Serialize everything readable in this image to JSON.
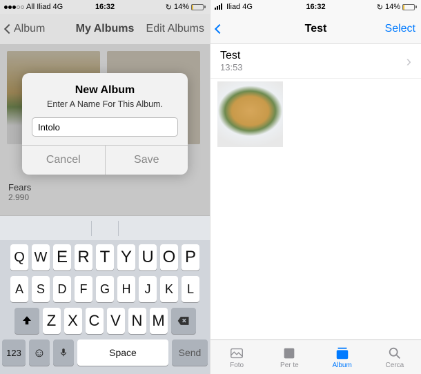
{
  "left": {
    "status": {
      "carrier": "All Iliad 4G",
      "time": "16:32",
      "battery_pct": "14%"
    },
    "nav": {
      "back": "Album",
      "title": "My Albums",
      "right": "Edit Albums"
    },
    "grid": {
      "album1_name": "Fears",
      "album1_count": "2.990"
    },
    "alert": {
      "title": "New Album",
      "message": "Enter A Name For This Album.",
      "input_value": "Intolo",
      "cancel": "Cancel",
      "save": "Save"
    },
    "keyboard": {
      "row1": [
        "Q",
        "W",
        "E",
        "R",
        "T",
        "Y",
        "U",
        "O",
        "P"
      ],
      "row2": [
        "A",
        "S",
        "D",
        "F",
        "G",
        "H",
        "J",
        "K",
        "L"
      ],
      "row3": [
        "Z",
        "X",
        "C",
        "V",
        "N",
        "M"
      ],
      "numkey": "123",
      "space": "Space",
      "send": "Send"
    }
  },
  "right": {
    "status": {
      "carrier": "Iliad 4G",
      "time": "16:32",
      "battery_pct": "14%"
    },
    "nav": {
      "back": "",
      "title": "Test",
      "right": "Select"
    },
    "header": {
      "title": "Test",
      "subtitle": "13:53"
    },
    "tabs": {
      "foto": "Foto",
      "perte": "Per te",
      "album": "Album",
      "cerca": "Cerca"
    }
  }
}
